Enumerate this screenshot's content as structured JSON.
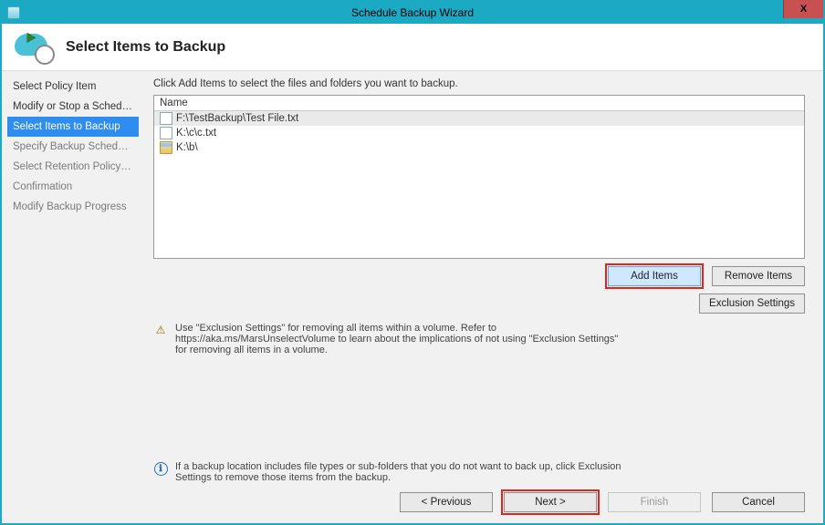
{
  "titlebar": {
    "title": "Schedule Backup Wizard",
    "close": "X"
  },
  "header": {
    "heading": "Select Items to Backup"
  },
  "sidebar": {
    "items": [
      {
        "label": "Select Policy Item",
        "active": false,
        "muted": false
      },
      {
        "label": "Modify or Stop a Schedul...",
        "active": false,
        "muted": false
      },
      {
        "label": "Select Items to Backup",
        "active": true,
        "muted": false
      },
      {
        "label": "Specify Backup Schedule ...",
        "active": false,
        "muted": true
      },
      {
        "label": "Select Retention Policy (F...",
        "active": false,
        "muted": true
      },
      {
        "label": "Confirmation",
        "active": false,
        "muted": true
      },
      {
        "label": "Modify Backup Progress",
        "active": false,
        "muted": true
      }
    ]
  },
  "content": {
    "instruction": "Click Add Items to select the files and folders you want to backup.",
    "list_header": "Name",
    "items": [
      {
        "label": "F:\\TestBackup\\Test File.txt",
        "kind": "doc",
        "selected": true
      },
      {
        "label": "K:\\c\\c.txt",
        "kind": "doc",
        "selected": false
      },
      {
        "label": "K:\\b\\",
        "kind": "folder",
        "selected": false
      }
    ],
    "buttons": {
      "add_items": "Add Items",
      "remove_items": "Remove Items",
      "exclusion_settings": "Exclusion Settings"
    },
    "warning": "Use \"Exclusion Settings\" for removing all items within a volume. Refer to https://aka.ms/MarsUnselectVolume to learn about the implications of not using \"Exclusion Settings\" for removing all items in a volume.",
    "info": "If a backup location includes file types or sub-folders that you do not want to back up, click Exclusion Settings to remove those items from the backup."
  },
  "footer": {
    "previous": "< Previous",
    "next": "Next >",
    "finish": "Finish",
    "cancel": "Cancel"
  }
}
